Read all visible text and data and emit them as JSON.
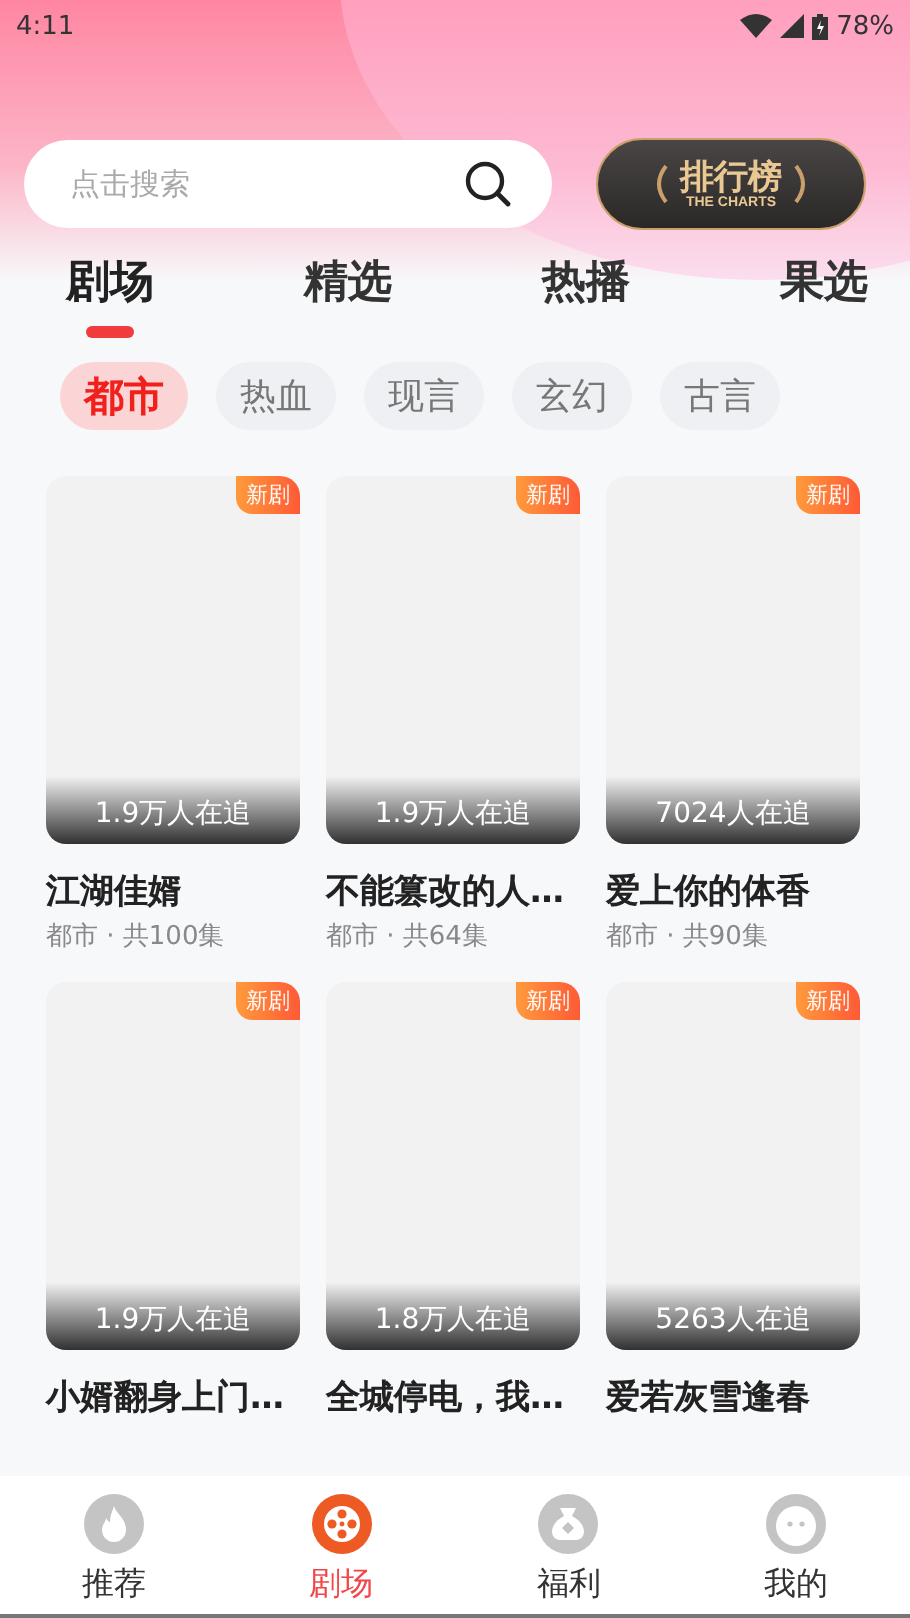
{
  "status_bar": {
    "time": "4:11",
    "battery": "78%"
  },
  "search": {
    "placeholder": "点击搜索"
  },
  "charts_button": {
    "title": "排行榜",
    "subtitle": "THE CHARTS"
  },
  "tabs": [
    {
      "label": "剧场",
      "selected": true
    },
    {
      "label": "精选",
      "selected": false
    },
    {
      "label": "热播",
      "selected": false
    },
    {
      "label": "果选",
      "selected": false
    }
  ],
  "categories": [
    {
      "label": "都市",
      "selected": true
    },
    {
      "label": "热血",
      "selected": false
    },
    {
      "label": "现言",
      "selected": false
    },
    {
      "label": "玄幻",
      "selected": false
    },
    {
      "label": "古言",
      "selected": false
    }
  ],
  "dramas": [
    {
      "badge": "新剧",
      "followers": "1.9万人在追",
      "title": "江湖佳婿",
      "meta": "都市 · 共100集"
    },
    {
      "badge": "新剧",
      "followers": "1.9万人在追",
      "title": "不能篡改的人…",
      "meta": "都市 · 共64集"
    },
    {
      "badge": "新剧",
      "followers": "7024人在追",
      "title": "爱上你的体香",
      "meta": "都市 · 共90集"
    },
    {
      "badge": "新剧",
      "followers": "1.9万人在追",
      "title": "小婿翻身上门…"
    },
    {
      "badge": "新剧",
      "followers": "1.8万人在追",
      "title": "全城停电，我…"
    },
    {
      "badge": "新剧",
      "followers": "5263人在追",
      "title": "爱若灰雪逢春"
    }
  ],
  "bottom_nav": [
    {
      "label": "推荐",
      "kind": "flame",
      "selected": false
    },
    {
      "label": "剧场",
      "kind": "reel",
      "selected": true
    },
    {
      "label": "福利",
      "kind": "bag",
      "selected": false
    },
    {
      "label": "我的",
      "kind": "face",
      "selected": false
    }
  ]
}
